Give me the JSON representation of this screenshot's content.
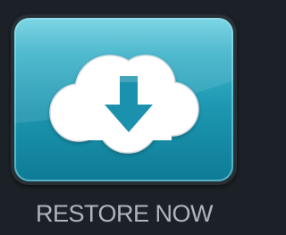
{
  "app": {
    "label": "RESTORE NOW",
    "icon": "cloud-download-icon",
    "colors": {
      "background": "#1b2127",
      "tile_top": "#6fd1e2",
      "tile_bottom": "#0e7b95",
      "cloud": "#ffffff",
      "arrow": "#1b91ad",
      "label": "#aeb6bc"
    }
  }
}
